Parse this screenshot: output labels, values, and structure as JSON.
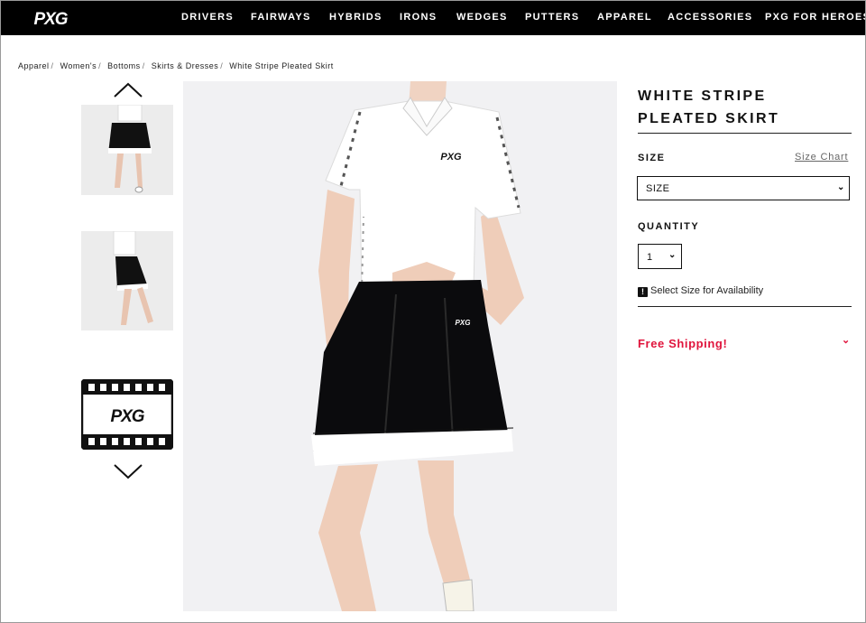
{
  "nav": {
    "logo_text": "PXG",
    "links": [
      "DRIVERS",
      "FAIRWAYS",
      "HYBRIDS",
      "IRONS",
      "WEDGES",
      "PUTTERS",
      "APPAREL",
      "ACCESSORIES",
      "PXG FOR HEROES"
    ]
  },
  "breadcrumb": [
    "Apparel",
    "Women's",
    "Bottoms",
    "Skirts & Dresses",
    "White Stripe Pleated Skirt"
  ],
  "gallery": {
    "up_icon": "chevron-up-icon",
    "down_icon": "chevron-down-icon",
    "video_logo": "PXG"
  },
  "product": {
    "title_line1": "WHITE STRIPE",
    "title_line2": "PLEATED SKIRT",
    "shirt_logo": "PXG",
    "skirt_logo": "PXG"
  },
  "size": {
    "label": "SIZE",
    "chart_link": "Size Chart",
    "select_value": "SIZE"
  },
  "quantity": {
    "label": "QUANTITY",
    "value": "1"
  },
  "availability": "Select Size for Availability",
  "shipping": "Free Shipping!",
  "colors": {
    "nav_bg": "#000000",
    "accent_red": "#e0143c",
    "image_bg": "#f1f1f3"
  }
}
